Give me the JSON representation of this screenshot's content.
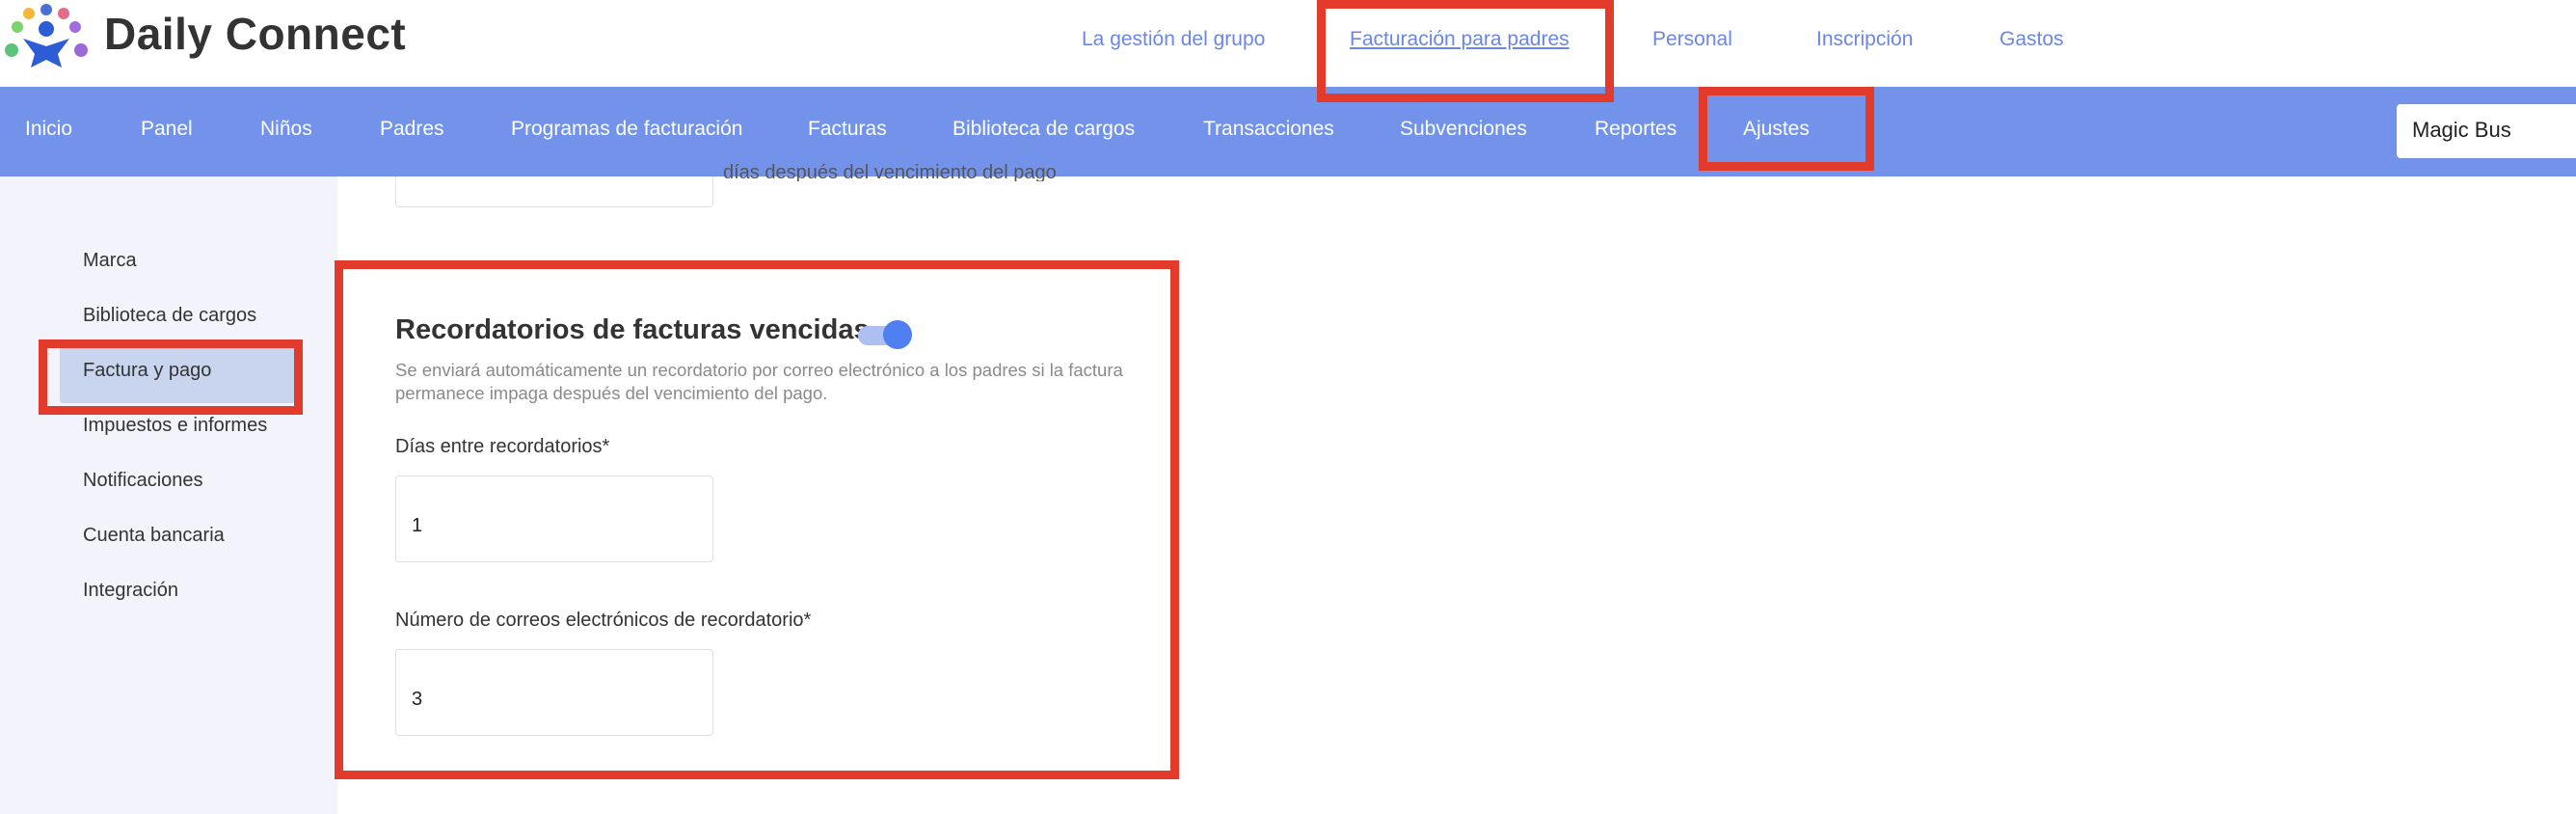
{
  "brand": {
    "name": "Daily Connect",
    "logo_icon": "people-logo-icon"
  },
  "top_nav": {
    "items": [
      {
        "label": "La gestión del grupo"
      },
      {
        "label": "Facturación para padres",
        "active": true
      },
      {
        "label": "Personal"
      },
      {
        "label": "Inscripción"
      },
      {
        "label": "Gastos"
      }
    ]
  },
  "main_nav": {
    "items": [
      {
        "label": "Inicio"
      },
      {
        "label": "Panel"
      },
      {
        "label": "Niños"
      },
      {
        "label": "Padres"
      },
      {
        "label": "Programas de facturación"
      },
      {
        "label": "Facturas"
      },
      {
        "label": "Biblioteca de cargos"
      },
      {
        "label": "Transacciones"
      },
      {
        "label": "Subvenciones"
      },
      {
        "label": "Reportes"
      },
      {
        "label": "Ajustes",
        "active": true
      }
    ],
    "school_selector": "Magic Bus"
  },
  "sidebar": {
    "items": [
      {
        "label": "Marca"
      },
      {
        "label": "Biblioteca de cargos"
      },
      {
        "label": "Factura y pago",
        "active": true
      },
      {
        "label": "Impuestos e informes"
      },
      {
        "label": "Notificaciones"
      },
      {
        "label": "Cuenta bancaria"
      },
      {
        "label": "Integración"
      }
    ]
  },
  "previous_section": {
    "partial_text": "días después del vencimiento del pago"
  },
  "reminders": {
    "title": "Recordatorios de facturas vencidas",
    "enabled": true,
    "description": "Se enviará automáticamente un recordatorio por correo electrónico a los padres si la factura permanece impaga después del vencimiento del pago.",
    "days_between_label": "Días entre recordatorios*",
    "days_between_value": "1",
    "count_label": "Número de correos electrónicos de recordatorio*",
    "count_value": "3"
  },
  "colors": {
    "nav_blue": "#7393ea",
    "link_blue": "#6b86e6",
    "highlight_red": "#e33b2b",
    "toggle_on": "#4f7ff0",
    "sidebar_active": "#c9d5ef"
  }
}
